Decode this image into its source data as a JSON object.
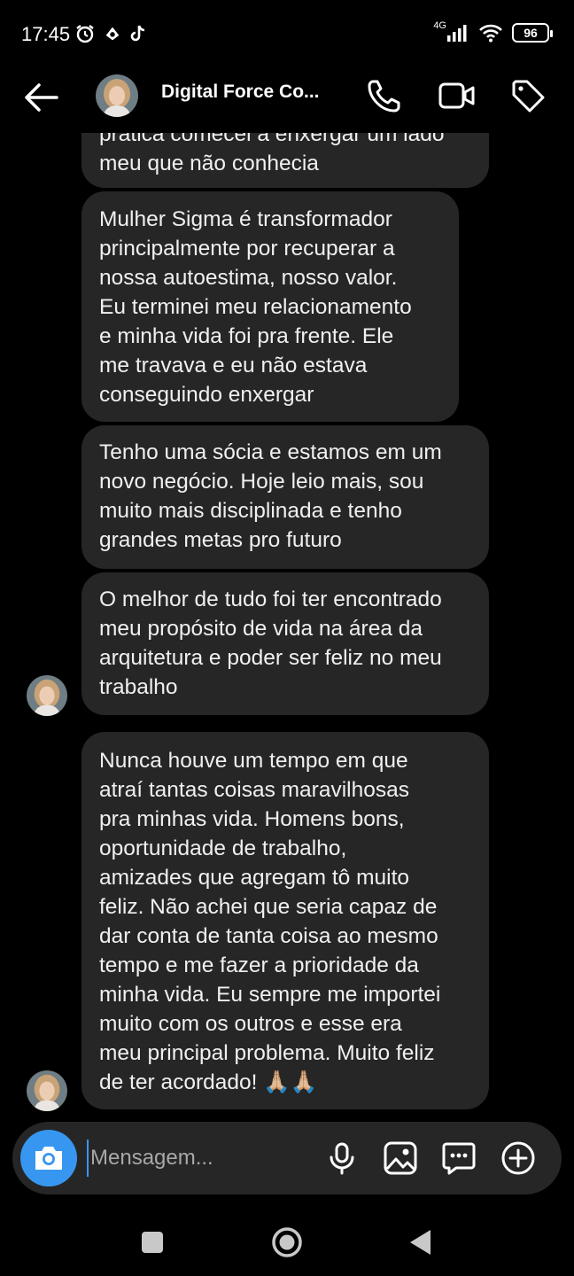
{
  "status_bar": {
    "time": "17:45",
    "network": "4G",
    "battery": "96"
  },
  "header": {
    "title": "Digital Force Co..."
  },
  "messages": [
    {
      "text": "prática comecei a enxergar um lado\nmeu que não conhecia"
    },
    {
      "text": "Mulher Sigma é transformador\nprincipalmente por recuperar a\nnossa autoestima, nosso valor.\nEu terminei meu relacionamento\ne minha vida foi pra frente. Ele\nme travava e eu não estava\nconseguindo enxergar"
    },
    {
      "text": "Tenho uma sócia e estamos em um\nnovo negócio. Hoje leio mais, sou\nmuito mais disciplinada e tenho\ngrandes metas pro futuro"
    },
    {
      "text": "O melhor de tudo foi ter encontrado\nmeu propósito de vida na área da\narquitetura e poder ser feliz no meu\ntrabalho"
    },
    {
      "text": "Nunca houve um tempo em que\natraí tantas coisas maravilhosas\npra minhas vida. Homens bons,\noportunidade de trabalho,\namizades que agregam tô muito\nfeliz. Não achei que seria capaz de\ndar conta de tanta coisa ao mesmo\ntempo e me fazer a prioridade da\nminha vida. Eu sempre me importei\nmuito com os outros e esse era\nmeu principal problema. Muito feliz\nde ter acordado! 🙏🏼🙏🏼"
    }
  ],
  "composer": {
    "placeholder": "Mensagem..."
  },
  "colors": {
    "accent": "#3797f0",
    "bubble": "#262626",
    "background": "#000000"
  }
}
